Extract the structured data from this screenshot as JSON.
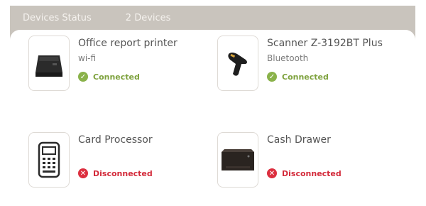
{
  "header": {
    "title": "Devices Status",
    "count": "2 Devices"
  },
  "colors": {
    "connected": "#8ab24a",
    "disconnected": "#dc2f3f",
    "overlay": "#c9c4bd"
  },
  "devices": [
    {
      "name": "Office report printer",
      "connection": "wi-fi",
      "status": "Connected",
      "icon": "receipt-printer-icon"
    },
    {
      "name": "Scanner Z-3192BT Plus",
      "connection": "Bluetooth",
      "status": "Connected",
      "icon": "barcode-scanner-icon"
    },
    {
      "name": "Card Processor",
      "connection": "",
      "status": "Disconnected",
      "icon": "card-terminal-icon"
    },
    {
      "name": "Cash Drawer",
      "connection": "",
      "status": "Disconnected",
      "icon": "cash-drawer-icon"
    }
  ]
}
